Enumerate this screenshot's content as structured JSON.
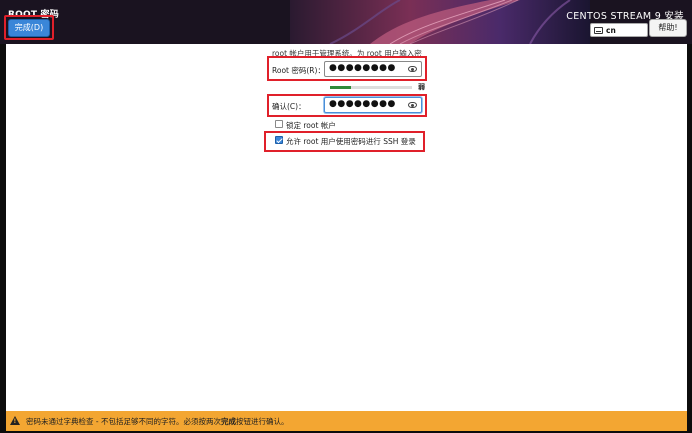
{
  "header": {
    "title": "ROOT 密码",
    "done_label": "完成(D)",
    "product_title": "CENTOS STREAM 9 安装",
    "keyboard_layout": "cn",
    "help_label": "帮助!"
  },
  "main": {
    "description": "root 帐户用于管理系统。为 root 用户输入密码。",
    "root_password_label": "Root 密码(R)：",
    "root_password_value": "●●●●●●●●",
    "confirm_label": "确认(C)：",
    "confirm_value": "●●●●●●●●",
    "strength_label": "弱",
    "strength_fraction": 0.25,
    "lock_root_label": "锁定 root 帐户",
    "lock_root_checked": false,
    "allow_ssh_label": "允许 root 用户使用密码进行 SSH 登录",
    "allow_ssh_checked": true
  },
  "footer": {
    "warning_before": "密码未通过字典检查 - 不包括足够不同的字符。必须按两次",
    "warning_bold": "完成",
    "warning_after": "按钮进行确认。"
  },
  "colors": {
    "accent": "#3a86d8",
    "highlight_outline": "#e0202a",
    "warning_bar": "#f3a632",
    "strength_weak": "#2e8b3a"
  }
}
